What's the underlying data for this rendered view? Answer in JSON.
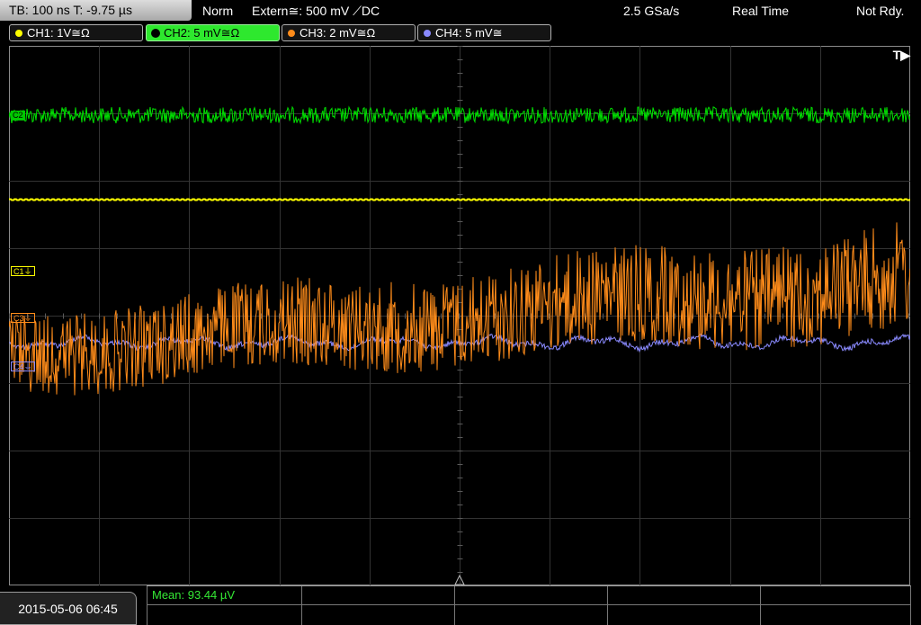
{
  "topbar": {
    "timebase": "TB: 100 ns   T: -9.75 µs",
    "mode": "Norm",
    "trigger": "Extern≅: 500 mV ⟋DC",
    "sample_rate": "2.5 GSa/s",
    "acq_mode": "Real Time",
    "status": "Not Rdy."
  },
  "channels": [
    {
      "label": "CH1: 1V≅Ω",
      "color": "#ffff00",
      "active": false
    },
    {
      "label": "CH2: 5 mV≅Ω",
      "color": "#00ff00",
      "active": true
    },
    {
      "label": "CH3: 2 mV≅Ω",
      "color": "#ff8c1a",
      "active": false
    },
    {
      "label": "CH4: 5 mV≅",
      "color": "#8a8aff",
      "active": false
    }
  ],
  "display": {
    "trigger_marker": "T▶",
    "level_markers": {
      "ch2": "C2",
      "ch1": "C1⏚",
      "ch3": "C3⏚",
      "ch4": "C4⏚"
    }
  },
  "footer": {
    "datetime": "2015-05-06 06:45",
    "measurement": "Mean: 93.44 µV"
  }
}
